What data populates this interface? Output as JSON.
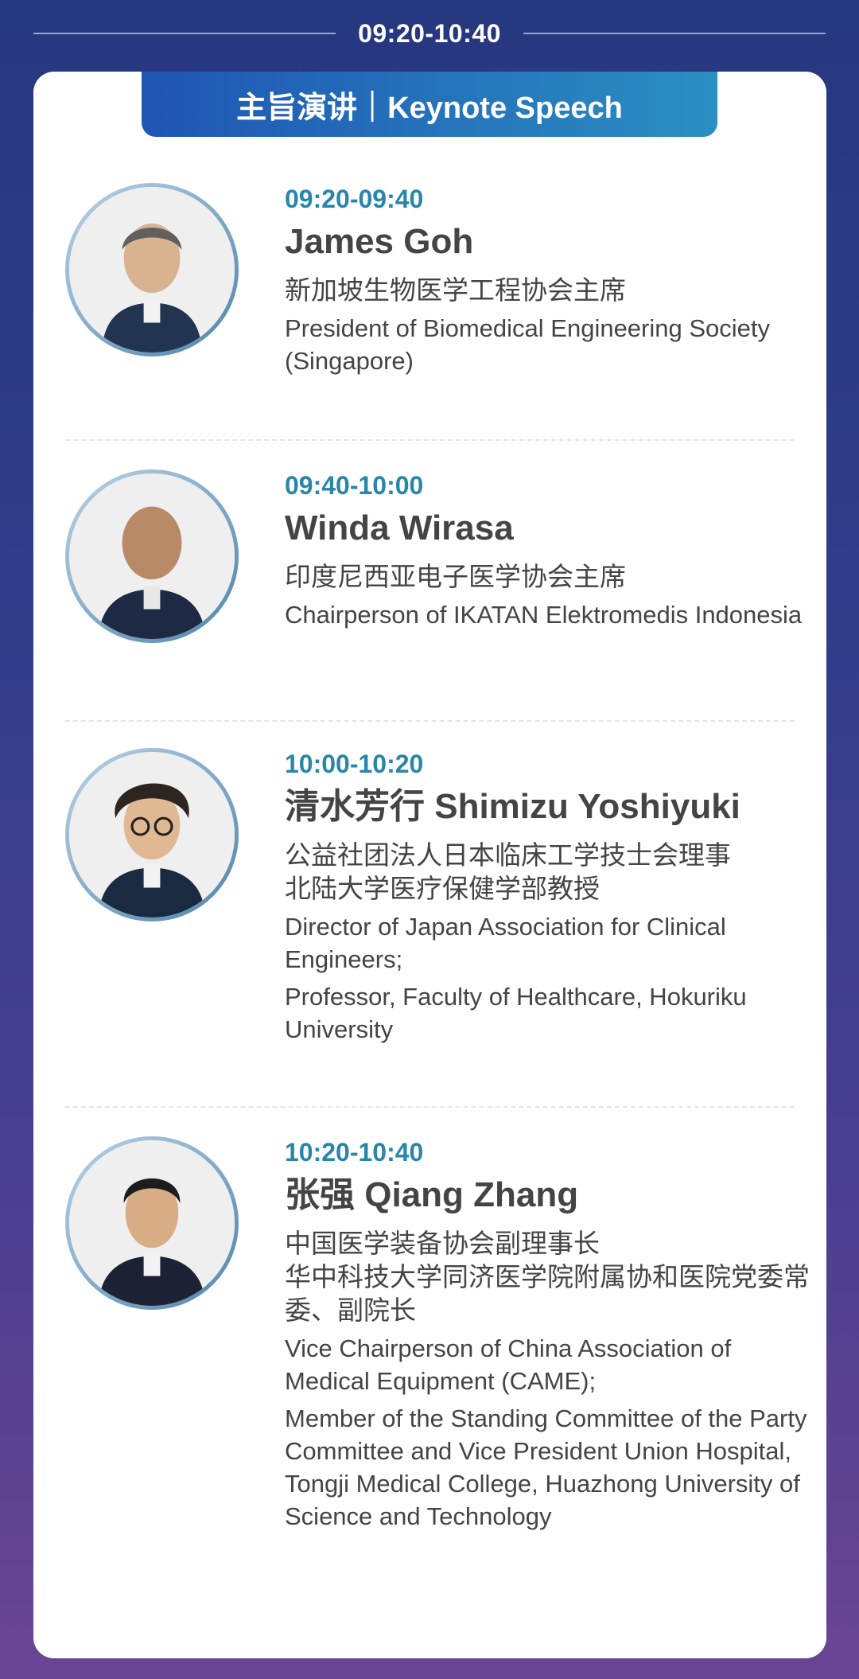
{
  "session": {
    "time": "09:20-10:40"
  },
  "section": {
    "title": "主旨演讲｜Keynote Speech"
  },
  "speakers": [
    {
      "time": "09:20-09:40",
      "name": "James Goh",
      "zh_titles": [
        "新加坡生物医学工程协会主席"
      ],
      "en_titles": [
        "President of Biomedical Engineering Society (Singapore)"
      ]
    },
    {
      "time": "09:40-10:00",
      "name": "Winda Wirasa",
      "zh_titles": [
        "印度尼西亚电子医学协会主席"
      ],
      "en_titles": [
        "Chairperson of IKATAN Elektromedis Indonesia"
      ]
    },
    {
      "time": "10:00-10:20",
      "name": "清水芳行 Shimizu Yoshiyuki",
      "zh_titles": [
        "公益社团法人日本临床工学技士会理事",
        "北陆大学医疗保健学部教授"
      ],
      "en_titles": [
        "Director of Japan Association for Clinical Engineers;",
        "Professor, Faculty of Healthcare, Hokuriku University"
      ]
    },
    {
      "time": "10:20-10:40",
      "name": "张强 Qiang Zhang",
      "zh_titles": [
        "中国医学装备协会副理事长",
        "华中科技大学同济医学院附属协和医院党委常委、副院长"
      ],
      "en_titles": [
        "Vice Chairperson of China Association of Medical Equipment (CAME);",
        "Member of the Standing Committee of the Party Committee and Vice President Union Hospital, Tongji Medical College, Huazhong University of Science and Technology"
      ]
    }
  ]
}
